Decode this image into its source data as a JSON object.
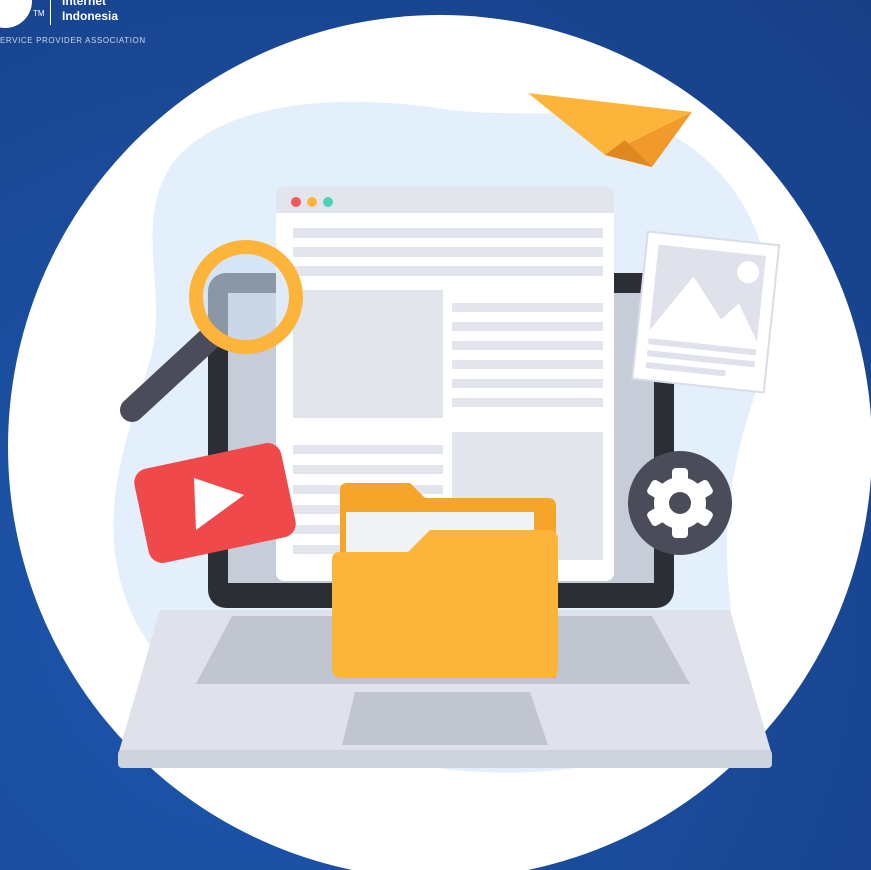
{
  "logo": {
    "tm": "TM",
    "line1": "Internet",
    "line2": "Indonesia",
    "tagline": "ERVICE PROVIDER ASSOCIATION"
  },
  "colors": {
    "background": "#1b4d9f",
    "circle": "#ffffff",
    "blob": "#e4effc",
    "laptop_frame": "#2b2e35",
    "laptop_base": "#dfe2ea",
    "folder": "#fcb53a",
    "magnifier_ring": "#fcb53a",
    "play_button": "#f0494b",
    "gear_badge": "#4a4d59",
    "paper_plane": "#fcb53a",
    "window_dots": [
      "#f15a5a",
      "#fcb53a",
      "#4fd1b5"
    ]
  },
  "icons": [
    "paper-plane-icon",
    "magnifier-icon",
    "image-icon",
    "play-icon",
    "gear-icon",
    "folder-icon",
    "laptop-icon",
    "browser-window-icon"
  ]
}
